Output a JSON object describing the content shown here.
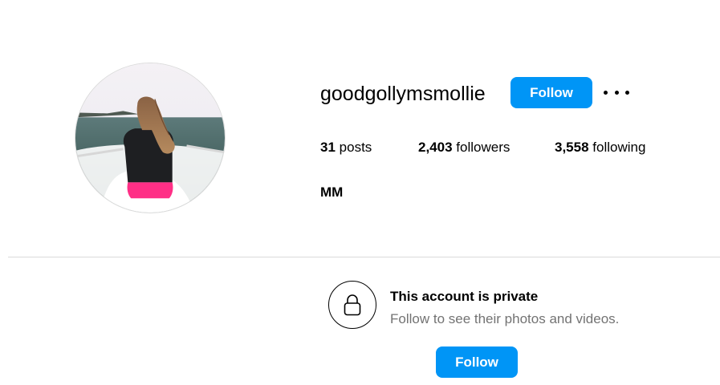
{
  "profile": {
    "username": "goodgollymsmollie",
    "follow_label": "Follow",
    "more_icon": "more-horizontal-icon",
    "stats": {
      "posts_count": "31",
      "posts_label": "posts",
      "followers_count": "2,403",
      "followers_label": "followers",
      "following_count": "3,558",
      "following_label": "following"
    },
    "full_name": "MM"
  },
  "private_notice": {
    "icon": "lock-icon",
    "title": "This account is private",
    "subtitle": "Follow to see their photos and videos.",
    "follow_label": "Follow"
  },
  "colors": {
    "accent": "#0095f6",
    "muted_text": "#737373",
    "divider": "#dbdbdb"
  }
}
